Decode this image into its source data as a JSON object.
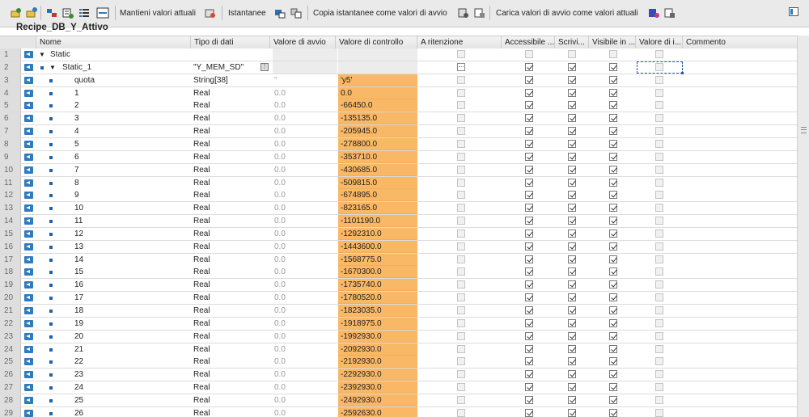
{
  "toolbar": {
    "labels": {
      "keep_actual": "Mantieni valori attuali",
      "snapshot": "Istantanee",
      "copy_snapshot": "Copia istantanee come valori di avvio",
      "load_start": "Carica valori di avvio come valori attuali"
    }
  },
  "title": "Recipe_DB_Y_Attivo",
  "columns": {
    "name": "Nome",
    "type": "Tipo di dati",
    "start": "Valore di avvio",
    "monitor": "Valore di controllo",
    "retain": "A ritenzione",
    "accessible": "Accessibile ...",
    "write": "Scrivi...",
    "visible": "Visibile in ...",
    "setpoint": "Valore di i...",
    "comment": "Commento"
  },
  "accent": {
    "monitor_bg": "#f9b866",
    "icon_blue": "#2e7bc0"
  },
  "rows": [
    {
      "n": "1",
      "name": "Static",
      "type": "",
      "start": "",
      "monitor": "",
      "level": 0,
      "expand": "▼",
      "icon": "",
      "retain": "gray",
      "acc": "gray",
      "wr": "gray",
      "vis": "gray",
      "sp": "gray"
    },
    {
      "n": "2",
      "name": "Static_1",
      "type": "\"Y_MEM_SD\"",
      "start": "",
      "monitor": "",
      "level": 1,
      "expand": "▼",
      "icon": "bullet",
      "retain": "dot",
      "acc": "on",
      "wr": "on",
      "vis": "on",
      "sp": "gray",
      "selected": true
    },
    {
      "n": "3",
      "name": "quota",
      "type": "String[38]",
      "start": "''",
      "monitor": "'y5'",
      "level": 2,
      "expand": "",
      "icon": "bullet",
      "retain": "gray",
      "acc": "on",
      "wr": "on",
      "vis": "on",
      "sp": "gray"
    },
    {
      "n": "4",
      "name": "1",
      "type": "Real",
      "start": "0.0",
      "monitor": "0.0",
      "level": 2,
      "expand": "",
      "icon": "bullet",
      "retain": "gray",
      "acc": "on",
      "wr": "on",
      "vis": "on",
      "sp": "gray"
    },
    {
      "n": "5",
      "name": "2",
      "type": "Real",
      "start": "0.0",
      "monitor": "-66450.0",
      "level": 2,
      "expand": "",
      "icon": "bullet",
      "retain": "gray",
      "acc": "on",
      "wr": "on",
      "vis": "on",
      "sp": "gray"
    },
    {
      "n": "6",
      "name": "3",
      "type": "Real",
      "start": "0.0",
      "monitor": "-135135.0",
      "level": 2,
      "expand": "",
      "icon": "bullet",
      "retain": "gray",
      "acc": "on",
      "wr": "on",
      "vis": "on",
      "sp": "gray"
    },
    {
      "n": "7",
      "name": "4",
      "type": "Real",
      "start": "0.0",
      "monitor": "-205945.0",
      "level": 2,
      "expand": "",
      "icon": "bullet",
      "retain": "gray",
      "acc": "on",
      "wr": "on",
      "vis": "on",
      "sp": "gray"
    },
    {
      "n": "8",
      "name": "5",
      "type": "Real",
      "start": "0.0",
      "monitor": "-278800.0",
      "level": 2,
      "expand": "",
      "icon": "bullet",
      "retain": "gray",
      "acc": "on",
      "wr": "on",
      "vis": "on",
      "sp": "gray"
    },
    {
      "n": "9",
      "name": "6",
      "type": "Real",
      "start": "0.0",
      "monitor": "-353710.0",
      "level": 2,
      "expand": "",
      "icon": "bullet",
      "retain": "gray",
      "acc": "on",
      "wr": "on",
      "vis": "on",
      "sp": "gray"
    },
    {
      "n": "10",
      "name": "7",
      "type": "Real",
      "start": "0.0",
      "monitor": "-430685.0",
      "level": 2,
      "expand": "",
      "icon": "bullet",
      "retain": "gray",
      "acc": "on",
      "wr": "on",
      "vis": "on",
      "sp": "gray"
    },
    {
      "n": "11",
      "name": "8",
      "type": "Real",
      "start": "0.0",
      "monitor": "-509815.0",
      "level": 2,
      "expand": "",
      "icon": "bullet",
      "retain": "gray",
      "acc": "on",
      "wr": "on",
      "vis": "on",
      "sp": "gray"
    },
    {
      "n": "12",
      "name": "9",
      "type": "Real",
      "start": "0.0",
      "monitor": "-674895.0",
      "level": 2,
      "expand": "",
      "icon": "bullet",
      "retain": "gray",
      "acc": "on",
      "wr": "on",
      "vis": "on",
      "sp": "gray"
    },
    {
      "n": "13",
      "name": "10",
      "type": "Real",
      "start": "0.0",
      "monitor": "-823165.0",
      "level": 2,
      "expand": "",
      "icon": "bullet",
      "retain": "gray",
      "acc": "on",
      "wr": "on",
      "vis": "on",
      "sp": "gray"
    },
    {
      "n": "14",
      "name": "11",
      "type": "Real",
      "start": "0.0",
      "monitor": "-1101190.0",
      "level": 2,
      "expand": "",
      "icon": "bullet",
      "retain": "gray",
      "acc": "on",
      "wr": "on",
      "vis": "on",
      "sp": "gray"
    },
    {
      "n": "15",
      "name": "12",
      "type": "Real",
      "start": "0.0",
      "monitor": "-1292310.0",
      "level": 2,
      "expand": "",
      "icon": "bullet",
      "retain": "gray",
      "acc": "on",
      "wr": "on",
      "vis": "on",
      "sp": "gray"
    },
    {
      "n": "16",
      "name": "13",
      "type": "Real",
      "start": "0.0",
      "monitor": "-1443600.0",
      "level": 2,
      "expand": "",
      "icon": "bullet",
      "retain": "gray",
      "acc": "on",
      "wr": "on",
      "vis": "on",
      "sp": "gray"
    },
    {
      "n": "17",
      "name": "14",
      "type": "Real",
      "start": "0.0",
      "monitor": "-1568775.0",
      "level": 2,
      "expand": "",
      "icon": "bullet",
      "retain": "gray",
      "acc": "on",
      "wr": "on",
      "vis": "on",
      "sp": "gray"
    },
    {
      "n": "18",
      "name": "15",
      "type": "Real",
      "start": "0.0",
      "monitor": "-1670300.0",
      "level": 2,
      "expand": "",
      "icon": "bullet",
      "retain": "gray",
      "acc": "on",
      "wr": "on",
      "vis": "on",
      "sp": "gray"
    },
    {
      "n": "19",
      "name": "16",
      "type": "Real",
      "start": "0.0",
      "monitor": "-1735740.0",
      "level": 2,
      "expand": "",
      "icon": "bullet",
      "retain": "gray",
      "acc": "on",
      "wr": "on",
      "vis": "on",
      "sp": "gray"
    },
    {
      "n": "20",
      "name": "17",
      "type": "Real",
      "start": "0.0",
      "monitor": "-1780520.0",
      "level": 2,
      "expand": "",
      "icon": "bullet",
      "retain": "gray",
      "acc": "on",
      "wr": "on",
      "vis": "on",
      "sp": "gray"
    },
    {
      "n": "21",
      "name": "18",
      "type": "Real",
      "start": "0.0",
      "monitor": "-1823035.0",
      "level": 2,
      "expand": "",
      "icon": "bullet",
      "retain": "gray",
      "acc": "on",
      "wr": "on",
      "vis": "on",
      "sp": "gray"
    },
    {
      "n": "22",
      "name": "19",
      "type": "Real",
      "start": "0.0",
      "monitor": "-1918975.0",
      "level": 2,
      "expand": "",
      "icon": "bullet",
      "retain": "gray",
      "acc": "on",
      "wr": "on",
      "vis": "on",
      "sp": "gray"
    },
    {
      "n": "23",
      "name": "20",
      "type": "Real",
      "start": "0.0",
      "monitor": "-1992930.0",
      "level": 2,
      "expand": "",
      "icon": "bullet",
      "retain": "gray",
      "acc": "on",
      "wr": "on",
      "vis": "on",
      "sp": "gray"
    },
    {
      "n": "24",
      "name": "21",
      "type": "Real",
      "start": "0.0",
      "monitor": "-2092930.0",
      "level": 2,
      "expand": "",
      "icon": "bullet",
      "retain": "gray",
      "acc": "on",
      "wr": "on",
      "vis": "on",
      "sp": "gray"
    },
    {
      "n": "25",
      "name": "22",
      "type": "Real",
      "start": "0.0",
      "monitor": "-2192930.0",
      "level": 2,
      "expand": "",
      "icon": "bullet",
      "retain": "gray",
      "acc": "on",
      "wr": "on",
      "vis": "on",
      "sp": "gray"
    },
    {
      "n": "26",
      "name": "23",
      "type": "Real",
      "start": "0.0",
      "monitor": "-2292930.0",
      "level": 2,
      "expand": "",
      "icon": "bullet",
      "retain": "gray",
      "acc": "on",
      "wr": "on",
      "vis": "on",
      "sp": "gray"
    },
    {
      "n": "27",
      "name": "24",
      "type": "Real",
      "start": "0.0",
      "monitor": "-2392930.0",
      "level": 2,
      "expand": "",
      "icon": "bullet",
      "retain": "gray",
      "acc": "on",
      "wr": "on",
      "vis": "on",
      "sp": "gray"
    },
    {
      "n": "28",
      "name": "25",
      "type": "Real",
      "start": "0.0",
      "monitor": "-2492930.0",
      "level": 2,
      "expand": "",
      "icon": "bullet",
      "retain": "gray",
      "acc": "on",
      "wr": "on",
      "vis": "on",
      "sp": "gray"
    },
    {
      "n": "29",
      "name": "26",
      "type": "Real",
      "start": "0.0",
      "monitor": "-2592630.0",
      "level": 2,
      "expand": "",
      "icon": "bullet",
      "retain": "gray",
      "acc": "on",
      "wr": "on",
      "vis": "on",
      "sp": "gray"
    }
  ]
}
